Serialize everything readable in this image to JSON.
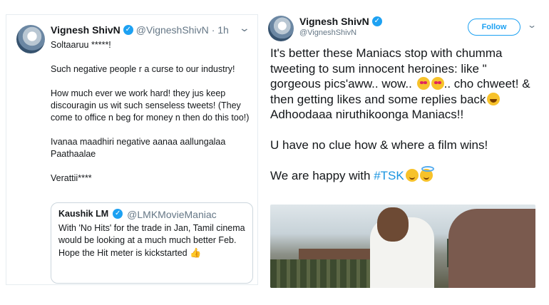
{
  "left_tweet": {
    "name": "Vignesh ShivN",
    "handle": "@VigneshShivN",
    "time": "· 1h",
    "lines": [
      "Soltaaruu *****!",
      "",
      "Such negative people r a curse to our industry!",
      "",
      "How much ever we work hard! they jus keep discouragin us wit such senseless tweets! (They come to office n beg for money n then do this too!)",
      "",
      "Ivanaa maadhiri negative aanaa aallungalaa Paathaalae",
      "",
      "Verattii****"
    ],
    "quote": {
      "name": "Kaushik LM",
      "handle": "@LMKMovieManiac",
      "text": "With 'No Hits' for the trade in Jan, Tamil cinema would be looking at a much much better Feb. Hope the Hit meter is kickstarted"
    }
  },
  "right_tweet": {
    "name": "Vignesh ShivN",
    "handle": "@VigneshShivN",
    "follow_label": "Follow",
    "text_part1": "It's better these Maniacs stop with chumma tweeting to sum innocent heroines: like \" gorgeous pics'aww.. wow..",
    "text_part2": ".. cho chweet! & then getting likes and some replies back",
    "line2": "Adhoodaaa niruthikoonga Maniacs!!",
    "line3": "U have no clue how & where a film wins!",
    "line4_prefix": "We are happy with ",
    "hashtag": "#TSK"
  },
  "icons": {
    "verified": "verified-badge-icon",
    "chevron": "chevron-down-icon",
    "thumb": "thumbs-up-emoji"
  },
  "colors": {
    "twitter_blue": "#1da1f2",
    "hashtag_blue": "#1b95e0",
    "secondary_text": "#657786"
  }
}
